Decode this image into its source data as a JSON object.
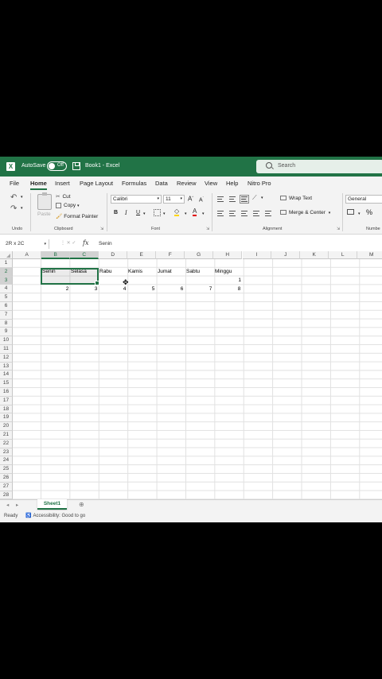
{
  "titlebar": {
    "app_icon": "excel-icon",
    "autosave_label": "AutoSave",
    "toggle_state": "Off",
    "document": "Book1 - Excel",
    "search_placeholder": "Search"
  },
  "tabs": [
    "File",
    "Home",
    "Insert",
    "Page Layout",
    "Formulas",
    "Data",
    "Review",
    "View",
    "Help",
    "Nitro Pro"
  ],
  "active_tab": "Home",
  "ribbon": {
    "undo_label": "Undo",
    "paste_label": "Paste",
    "cut_label": "Cut",
    "copy_label": "Copy",
    "format_painter_label": "Format Painter",
    "clipboard_label": "Clipboard",
    "font_name": "Calibri",
    "font_size": "11",
    "bold": "B",
    "italic": "I",
    "underline": "U",
    "font_label": "Font",
    "wrap_text": "Wrap Text",
    "merge_center": "Merge & Center",
    "alignment_label": "Alignment",
    "number_format": "General",
    "number_label": "Numbe",
    "percent": "%"
  },
  "formula_bar": {
    "name_box": "2R x 2C",
    "fx": "fx",
    "content": "Senin"
  },
  "grid": {
    "columns": [
      "A",
      "B",
      "C",
      "D",
      "E",
      "F",
      "G",
      "H",
      "I",
      "J",
      "K",
      "L",
      "M"
    ],
    "rows": [
      "1",
      "2",
      "3",
      "4",
      "5",
      "6",
      "7",
      "8",
      "9",
      "10",
      "11",
      "12",
      "13",
      "14",
      "15",
      "16",
      "17",
      "18",
      "19",
      "20",
      "21",
      "22",
      "23",
      "24",
      "25",
      "26",
      "27",
      "28"
    ],
    "row2": [
      "Senin",
      "Selasa",
      "Rabu",
      "Kamis",
      "Jumat",
      "Sabtu",
      "Minggu"
    ],
    "h3": "1",
    "row4": [
      "2",
      "3",
      "4",
      "5",
      "6",
      "7",
      "8"
    ]
  },
  "sheet_tab": "Sheet1",
  "status": {
    "ready": "Ready",
    "accessibility": "Accessibility: Good to go"
  },
  "colors": {
    "accent": "#217346",
    "background": "#f3f3f3"
  }
}
